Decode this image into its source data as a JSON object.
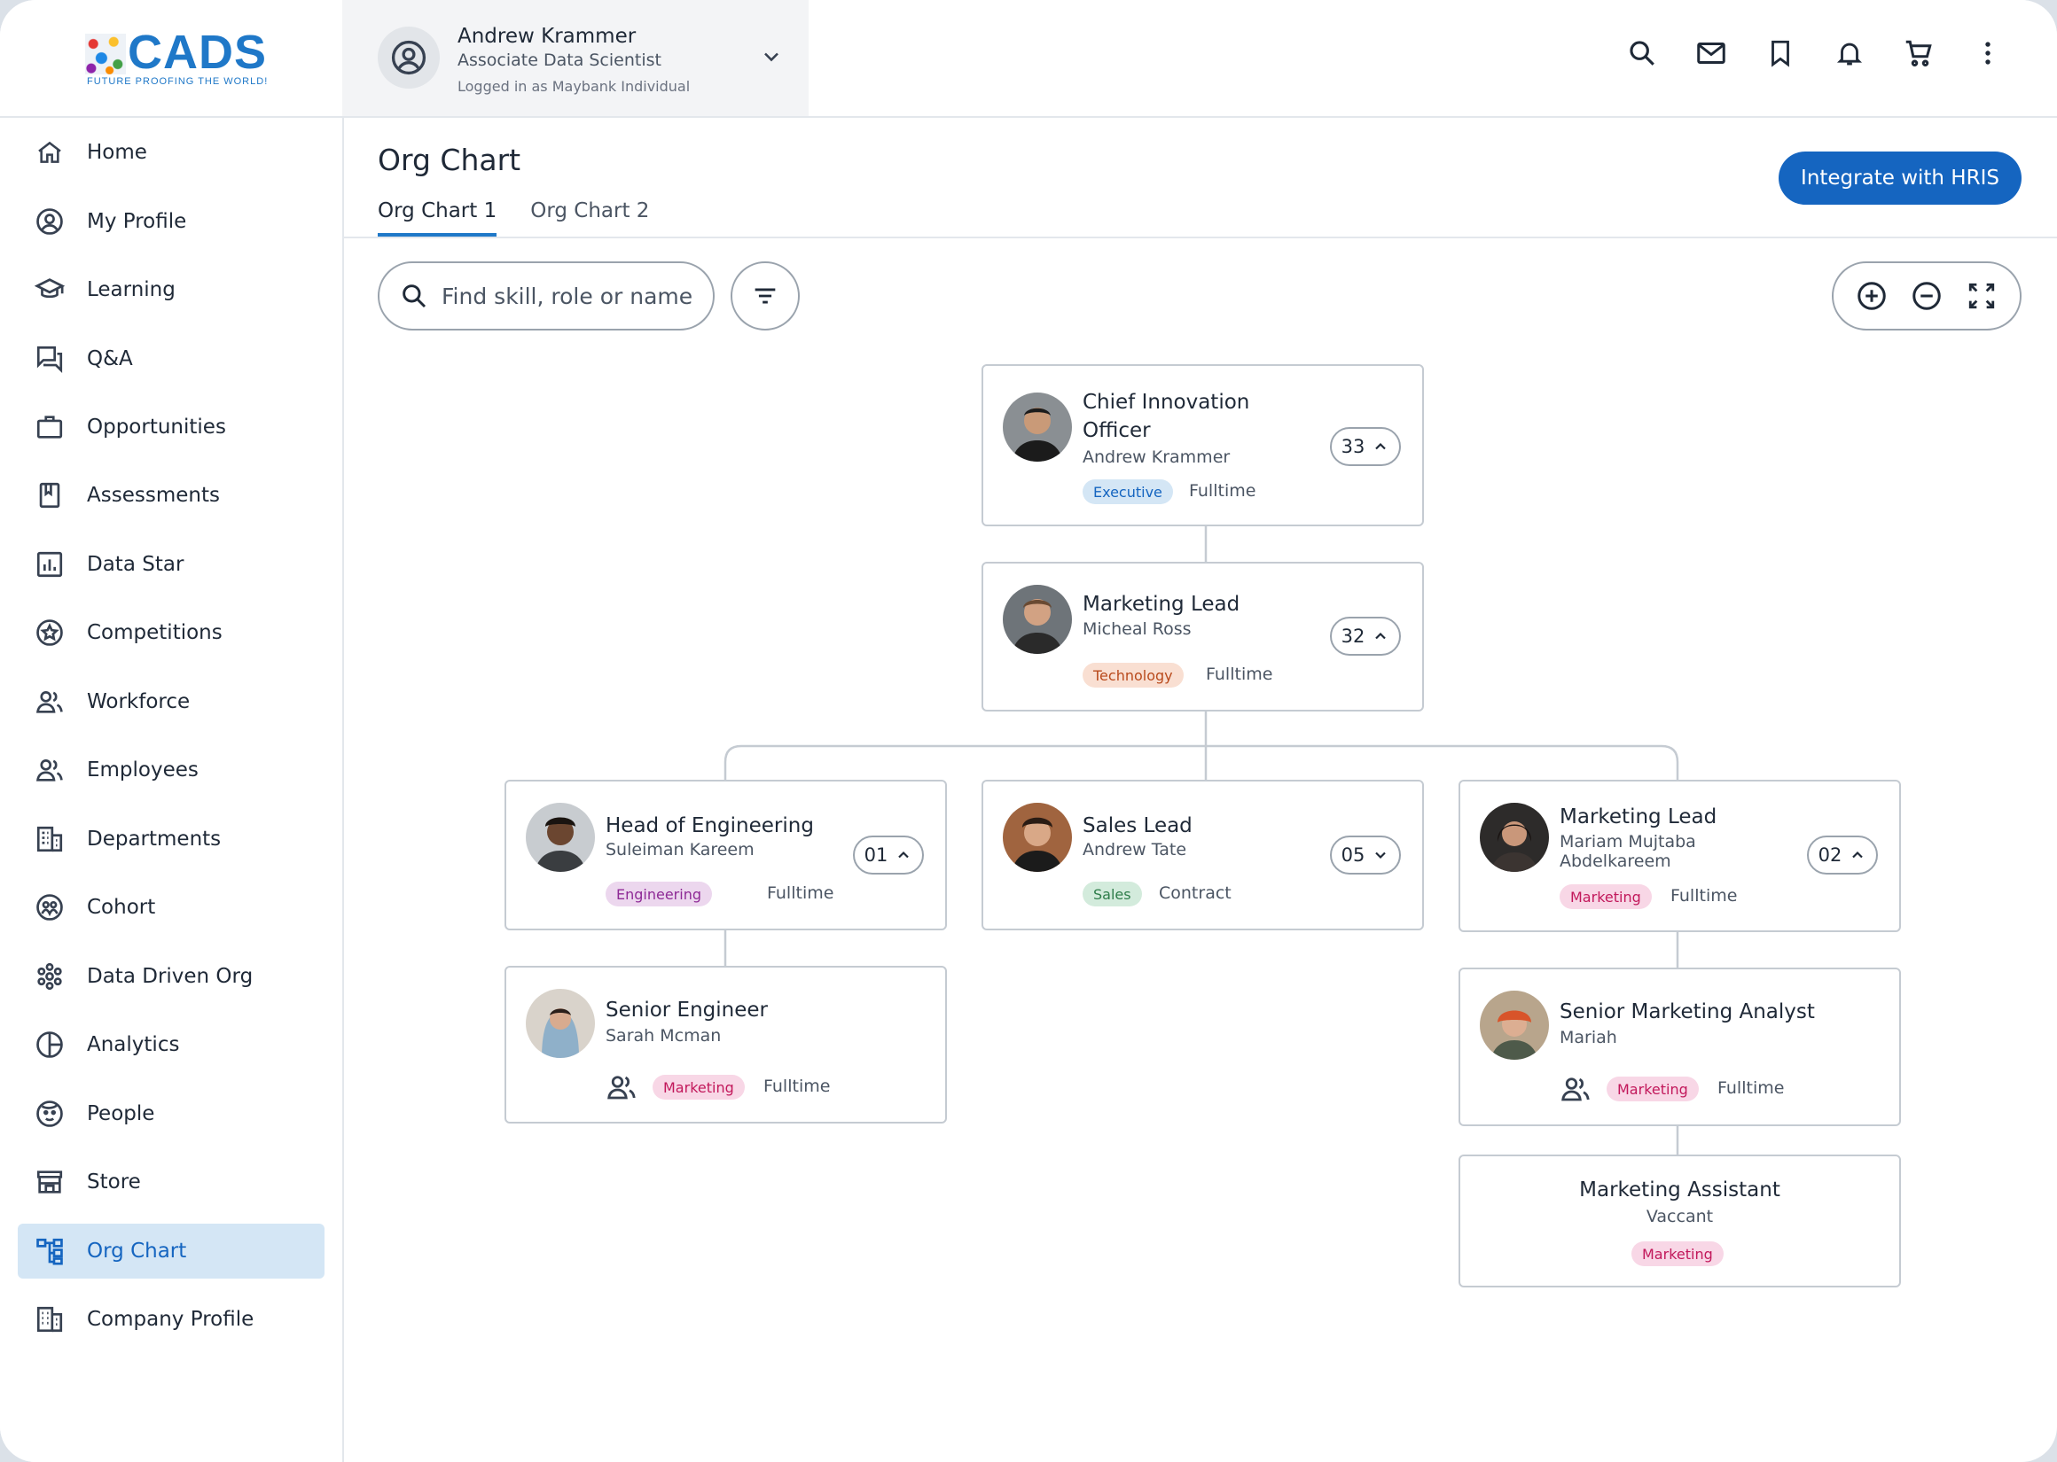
{
  "brand": {
    "word": "CADS",
    "tagline": "FUTURE PROOFING THE WORLD!",
    "accent": "#1f78c8"
  },
  "user": {
    "name": "Andrew Krammer",
    "role": "Associate Data Scientist",
    "logged": "Logged in as Maybank Individual"
  },
  "topbar_icons": [
    "search-icon",
    "mail-icon",
    "bookmark-icon",
    "bell-icon",
    "cart-icon",
    "more-vertical-icon"
  ],
  "sidebar": {
    "items": [
      {
        "label": "Home",
        "icon": "home-icon"
      },
      {
        "label": "My Profile",
        "icon": "user-circle-icon"
      },
      {
        "label": "Learning",
        "icon": "graduation-cap-icon"
      },
      {
        "label": "Q&A",
        "icon": "chat-icon"
      },
      {
        "label": "Opportunities",
        "icon": "briefcase-icon"
      },
      {
        "label": "Assessments",
        "icon": "book-icon"
      },
      {
        "label": "Data Star",
        "icon": "bar-chart-icon"
      },
      {
        "label": "Competitions",
        "icon": "star-badge-icon"
      },
      {
        "label": "Workforce",
        "icon": "people-icon"
      },
      {
        "label": "Employees",
        "icon": "people-icon"
      },
      {
        "label": "Departments",
        "icon": "building-icon"
      },
      {
        "label": "Cohort",
        "icon": "group-circle-icon"
      },
      {
        "label": "Data Driven Org",
        "icon": "hexagon-network-icon"
      },
      {
        "label": "Analytics",
        "icon": "pie-chart-icon"
      },
      {
        "label": "People",
        "icon": "face-icon"
      },
      {
        "label": "Store",
        "icon": "store-icon"
      },
      {
        "label": "Org Chart",
        "icon": "org-chart-icon",
        "active": true
      },
      {
        "label": "Company Profile",
        "icon": "office-building-icon"
      }
    ]
  },
  "main": {
    "title": "Org Chart",
    "tabs": [
      {
        "label": "Org Chart 1",
        "active": true
      },
      {
        "label": "Org Chart 2"
      }
    ],
    "integrate_label": "Integrate with HRIS",
    "search_placeholder": "Find skill, role or name"
  },
  "org": {
    "cio": {
      "title_line1": "Chief Innovation",
      "title_line2": "Officer",
      "name": "Andrew Krammer",
      "tag": "Executive",
      "type": "Fulltime",
      "count": "33"
    },
    "mkt_lead_top": {
      "title": "Marketing Lead",
      "name": "Micheal Ross",
      "tag": "Technology",
      "type": "Fulltime",
      "count": "32"
    },
    "head_eng": {
      "title": "Head of Engineering",
      "name": "Suleiman Kareem",
      "tag": "Engineering",
      "type": "Fulltime",
      "count": "01"
    },
    "sales_lead": {
      "title": "Sales Lead",
      "name": "Andrew Tate",
      "tag": "Sales",
      "type": "Contract",
      "count": "05"
    },
    "mkt_lead": {
      "title": "Marketing Lead",
      "name_line1": "Mariam Mujtaba",
      "name_line2": "Abdelkareem",
      "tag": "Marketing",
      "type": "Fulltime",
      "count": "02"
    },
    "senior_eng": {
      "title": "Senior Engineer",
      "name": "Sarah Mcman",
      "tag": "Marketing",
      "type": "Fulltime"
    },
    "senior_mkt": {
      "title": "Senior Marketing Analyst",
      "name": "Mariah",
      "tag": "Marketing",
      "type": "Fulltime"
    },
    "mkt_assist": {
      "title": "Marketing Assistant",
      "name": "Vaccant",
      "tag": "Marketing"
    }
  }
}
